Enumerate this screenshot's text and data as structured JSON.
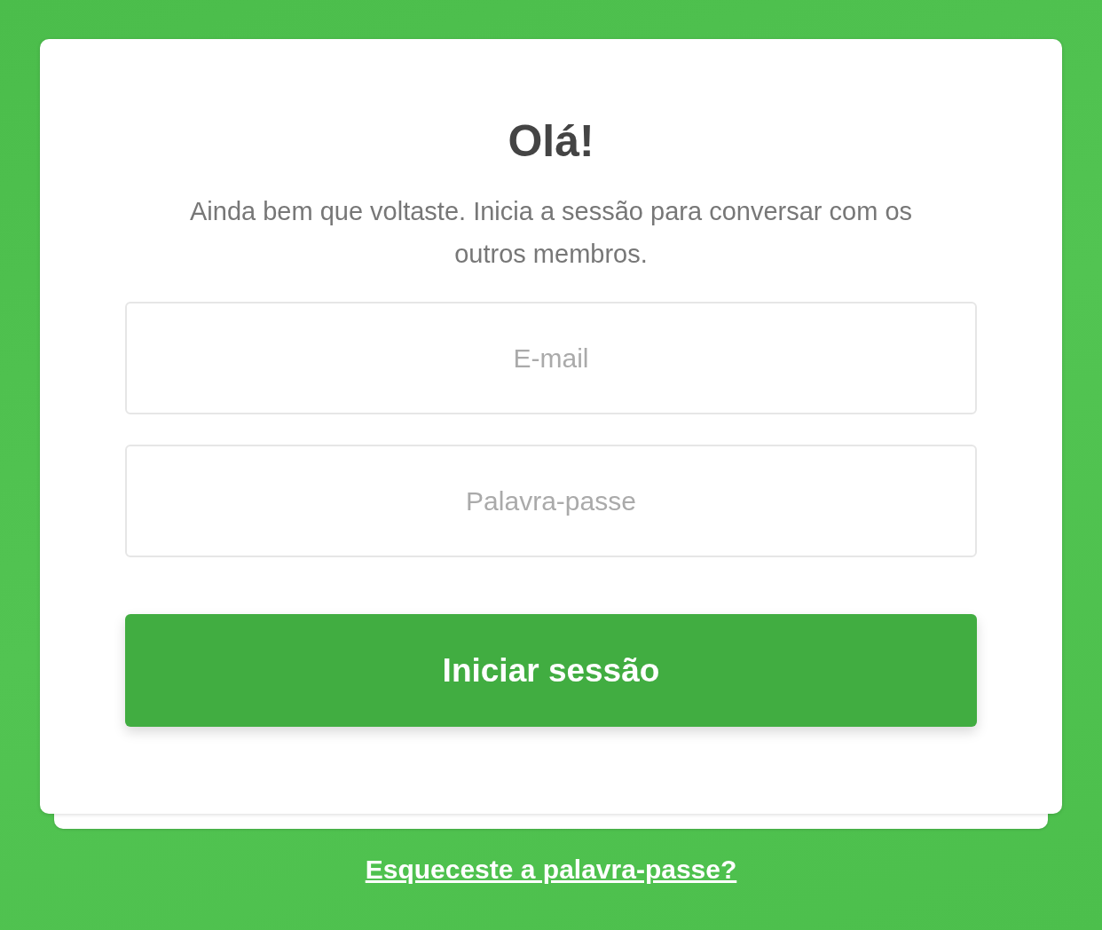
{
  "login": {
    "title": "Olá!",
    "subtitle": "Ainda bem que voltaste. Inicia a sessão para conversar com os outros membros.",
    "fields": [
      {
        "placeholder": "E-mail"
      },
      {
        "placeholder": "Palavra-passe"
      }
    ],
    "button": "Iniciar sessão"
  },
  "forgot_link": "Esqueceste a palavra-passe?"
}
